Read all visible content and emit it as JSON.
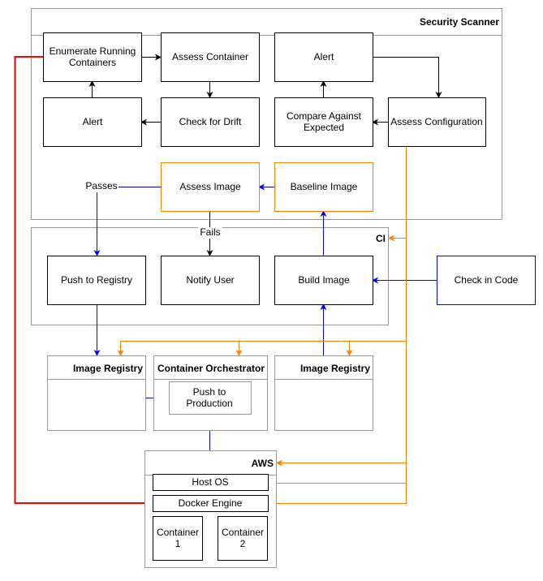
{
  "colors": {
    "black": "#000000",
    "blue": "#0000ff",
    "orange": "#ff8000",
    "red": "#ff0000",
    "container_border": "#999999"
  },
  "groups": {
    "security_scanner": "Security Scanner",
    "ci": "CI",
    "image_registry_1": "Image Registry",
    "container_orchestrator": "Container Orchestrator",
    "image_registry_2": "Image Registry",
    "aws": "AWS"
  },
  "nodes": {
    "enumerate": [
      "Enumerate Running",
      "Containers"
    ],
    "assess_container": "Assess Container",
    "alert_top": "Alert",
    "alert_left": "Alert",
    "check_drift": "Check for Drift",
    "compare": [
      "Compare Against",
      "Expected"
    ],
    "assess_config": "Assess Configuration",
    "assess_image": "Assess Image",
    "baseline_image": "Baseline Image",
    "push_registry": "Push to Registry",
    "notify_user": "Notify User",
    "build_image": "Build Image",
    "check_in_code": "Check in Code",
    "push_production": [
      "Push to",
      "Production"
    ],
    "host_os": "Host OS",
    "docker_engine": "Docker Engine",
    "container1": [
      "Container",
      "1"
    ],
    "container2": [
      "Container",
      "2"
    ]
  },
  "edge_labels": {
    "passes": "Passes",
    "fails": "Fails"
  }
}
